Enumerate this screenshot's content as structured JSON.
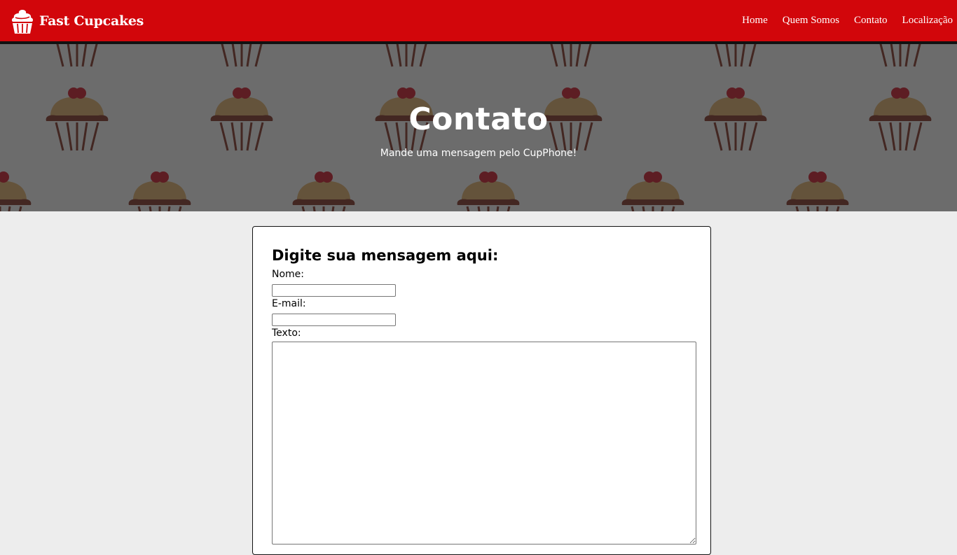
{
  "navbar": {
    "brand": "Fast Cupcakes",
    "brand_icon": "cupcake-icon",
    "links": [
      "Home",
      "Quem Somos",
      "Contato",
      "Localização"
    ],
    "background": "#d2060b"
  },
  "hero": {
    "title": "Contato",
    "subtitle": "Mande uma mensagem pelo CupPhone!"
  },
  "form": {
    "heading": "Digite sua mensagem aqui:",
    "name_label": "Nome:",
    "name_value": "",
    "email_label": "E-mail:",
    "email_value": "",
    "text_label": "Texto:",
    "text_value": ""
  }
}
